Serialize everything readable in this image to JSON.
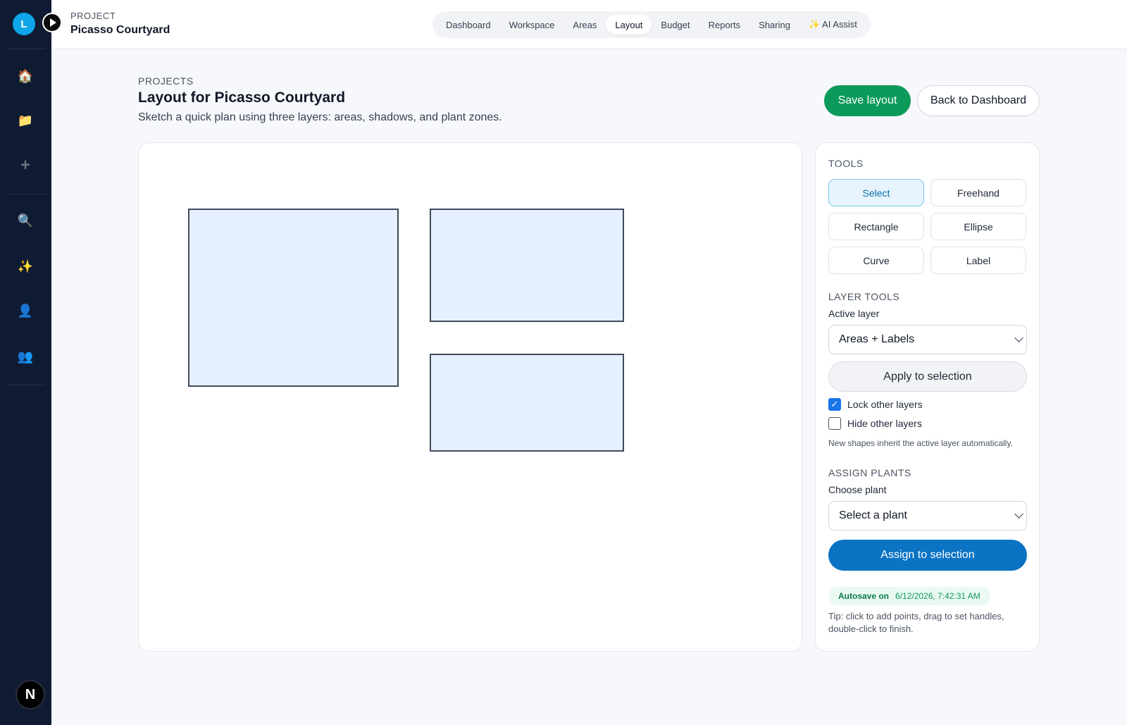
{
  "rail": {
    "avatar_letter": "L",
    "icons": [
      "home-icon",
      "folder-icon",
      "plus-icon",
      "search-icon",
      "sparkles-icon",
      "user-icon",
      "users-icon"
    ],
    "bottom_badge": "N"
  },
  "header": {
    "kicker": "PROJECT",
    "project_name": "Picasso Courtyard",
    "nav_tabs": [
      "Dashboard",
      "Workspace",
      "Areas",
      "Layout",
      "Budget",
      "Reports",
      "Sharing",
      "✨ AI Assist"
    ],
    "active_tab": "Layout"
  },
  "page": {
    "kicker": "PROJECTS",
    "title": "Layout for Picasso Courtyard",
    "subtitle": "Sketch a quick plan using three layers: areas, shadows, and plant zones.",
    "save_label": "Save layout",
    "back_label": "Back to Dashboard"
  },
  "canvas": {
    "shape_count": 3
  },
  "panel": {
    "tools_title": "TOOLS",
    "tools": [
      "Select",
      "Freehand",
      "Rectangle",
      "Ellipse",
      "Curve",
      "Label"
    ],
    "active_tool": "Select",
    "layer_title": "LAYER TOOLS",
    "active_layer_label": "Active layer",
    "active_layer_value": "Areas + Labels",
    "apply_label": "Apply to selection",
    "lock_label": "Lock other layers",
    "lock_checked": true,
    "hide_label": "Hide other layers",
    "hide_checked": false,
    "inherit_hint": "New shapes inherit the active layer automatically.",
    "plants_title": "ASSIGN PLANTS",
    "choose_plant_label": "Choose plant",
    "plant_placeholder": "Select a plant",
    "assign_label": "Assign to selection",
    "autosave_label": "Autosave on",
    "autosave_time": "6/12/2026, 7:42:31 AM",
    "tip": "Tip: click to add points, drag to set handles, double-click to finish."
  },
  "colors": {
    "rail": "#0f1b33",
    "save": "#0b9a5a",
    "assign": "#0a73c4",
    "shape_fill": "#e6f0ff"
  }
}
